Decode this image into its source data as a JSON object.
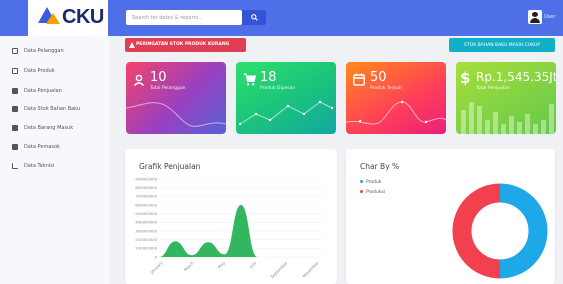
{
  "app": {
    "name": "CKU"
  },
  "search": {
    "placeholder": "Search for dates & reports..."
  },
  "user": {
    "label": "User"
  },
  "sidebar": {
    "items": [
      {
        "label": "Data Pelanggan",
        "icon": "table-icon"
      },
      {
        "label": "Data Produk",
        "icon": "box-icon"
      },
      {
        "label": "Data Penjualan",
        "icon": "receipt-icon"
      },
      {
        "label": "Data Stok Bahan Baku",
        "icon": "layers-icon"
      },
      {
        "label": "Data Barang Masuk",
        "icon": "inbox-icon"
      },
      {
        "label": "Data Pemasok",
        "icon": "truck-icon"
      },
      {
        "label": "Data Teknisi",
        "icon": "chart-icon"
      }
    ]
  },
  "alerts": {
    "warning_label": "PERINGATAN STOK PRODUK KURANG",
    "stock_label": "STOK BAHAN BAKU MASIH CUKUP"
  },
  "cards": [
    {
      "value": "10",
      "caption": "Total Pelanggan",
      "icon": "user-icon"
    },
    {
      "value": "18",
      "caption": "Produk Dipesan",
      "icon": "cart-icon"
    },
    {
      "value": "50",
      "caption": "Produk Terjual",
      "icon": "calendar-icon"
    },
    {
      "value": "Rp.1,545.35Jt",
      "caption": "Total Penjualan",
      "icon": "dollar-icon"
    }
  ],
  "sales_panel": {
    "title": "Grafik Penjualan"
  },
  "pie_panel": {
    "title": "Char By %",
    "legend": [
      {
        "label": "Produk",
        "color": "#1fa8e8"
      },
      {
        "label": "Produksi",
        "color": "#f2404f"
      }
    ]
  },
  "chart_data": [
    {
      "type": "area",
      "title": "Grafik Penjualan",
      "categories": [
        "January",
        "March",
        "May",
        "July",
        "September",
        "November"
      ],
      "y_ticks": [
        "900000000",
        "800000000",
        "700000000",
        "600000000",
        "500000000",
        "400000000",
        "300000000",
        "200000000",
        "100000000",
        "0"
      ],
      "ylim": [
        0,
        900000000
      ],
      "series": [
        {
          "values": [
            0,
            180000000,
            20000000,
            170000000,
            30000000,
            600000000,
            0,
            0,
            0,
            0,
            0
          ]
        }
      ],
      "color": "#1cae4e",
      "grid": true
    },
    {
      "type": "pie",
      "title": "Char By %",
      "labels": [
        "Produk",
        "Produksi"
      ],
      "values": [
        50,
        50
      ],
      "colors": [
        "#1fa8e8",
        "#f2404f"
      ],
      "donut": true
    }
  ]
}
